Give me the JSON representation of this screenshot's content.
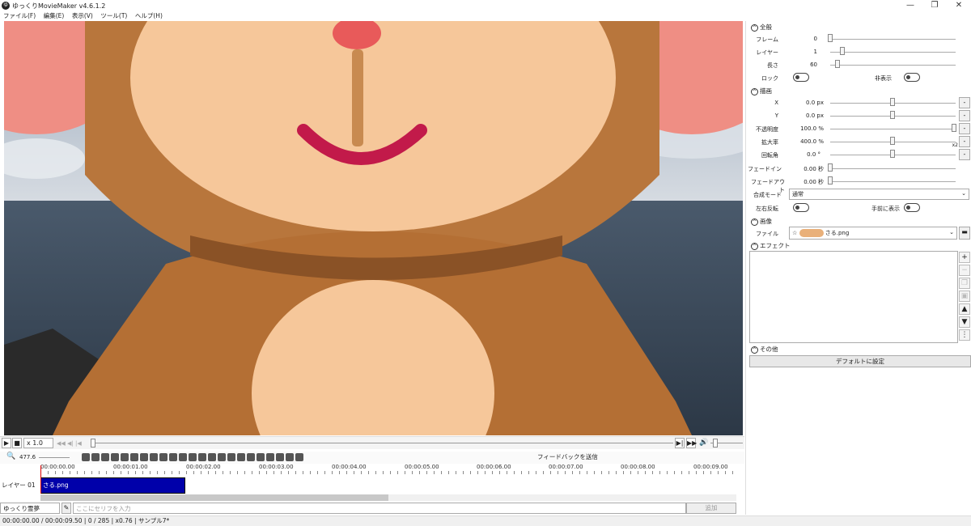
{
  "app": {
    "icon_char": "ゆ",
    "title": "ゆっくりMovieMaker v4.6.1.2"
  },
  "window_controls": {
    "minimize": "—",
    "maximize": "❐",
    "close": "✕"
  },
  "menu": [
    "ファイル(F)",
    "編集(E)",
    "表示(V)",
    "ツール(T)",
    "ヘルプ(H)"
  ],
  "playback": {
    "play": "▶",
    "stop": "■",
    "speed": "x 1.0",
    "volume_icon": "🔊"
  },
  "toolbar": {
    "zoom": "477.6",
    "feedback": "フィードバックを送信"
  },
  "timeline": {
    "ticks": [
      "00:00:00.00",
      "00:00:01.00",
      "00:00:02.00",
      "00:00:03.00",
      "00:00:04.00",
      "00:00:05.00",
      "00:00:06.00",
      "00:00:07.00",
      "00:00:08.00",
      "00:00:09.00"
    ],
    "layer_label": "レイヤー 01",
    "clip_label": "さる.png"
  },
  "dialogue": {
    "speaker": "ゆっくり霊夢",
    "placeholder": "ここにセリフを入力",
    "add": "追加"
  },
  "status": {
    "time": "00:00:00.00 / 00:00:09.50",
    "frame": "0 / 285",
    "zoom": "x0.76",
    "project": "サンプル7*"
  },
  "panel": {
    "general": {
      "title": "全般",
      "frame_label": "フレーム",
      "frame_value": "0",
      "layer_label": "レイヤー",
      "layer_value": "1",
      "length_label": "長さ",
      "length_value": "60",
      "lock_label": "ロック",
      "hide_label": "非表示"
    },
    "drawing": {
      "title": "描画",
      "x_label": "X",
      "x_value": "0.0 px",
      "y_label": "Y",
      "y_value": "0.0 px",
      "opacity_label": "不透明度",
      "opacity_value": "100.0 %",
      "scale_label": "拡大率",
      "scale_value": "400.0 %",
      "rotation_label": "回転角",
      "rotation_value": "0.0 °",
      "fadein_label": "フェードイン",
      "fadein_value": "0.00 秒",
      "fadeout_label": "フェードアウト",
      "fadeout_value": "0.00 秒",
      "blend_label": "合成モード",
      "blend_value": "通常",
      "flip_label": "左右反転",
      "front_label": "手前に表示",
      "x2": "x2"
    },
    "image": {
      "title": "画像",
      "file_label": "ファイル",
      "file_value": "さる.png"
    },
    "effect": {
      "title": "エフェクト"
    },
    "other": {
      "title": "その他",
      "default_button": "デフォルトに設定"
    }
  }
}
